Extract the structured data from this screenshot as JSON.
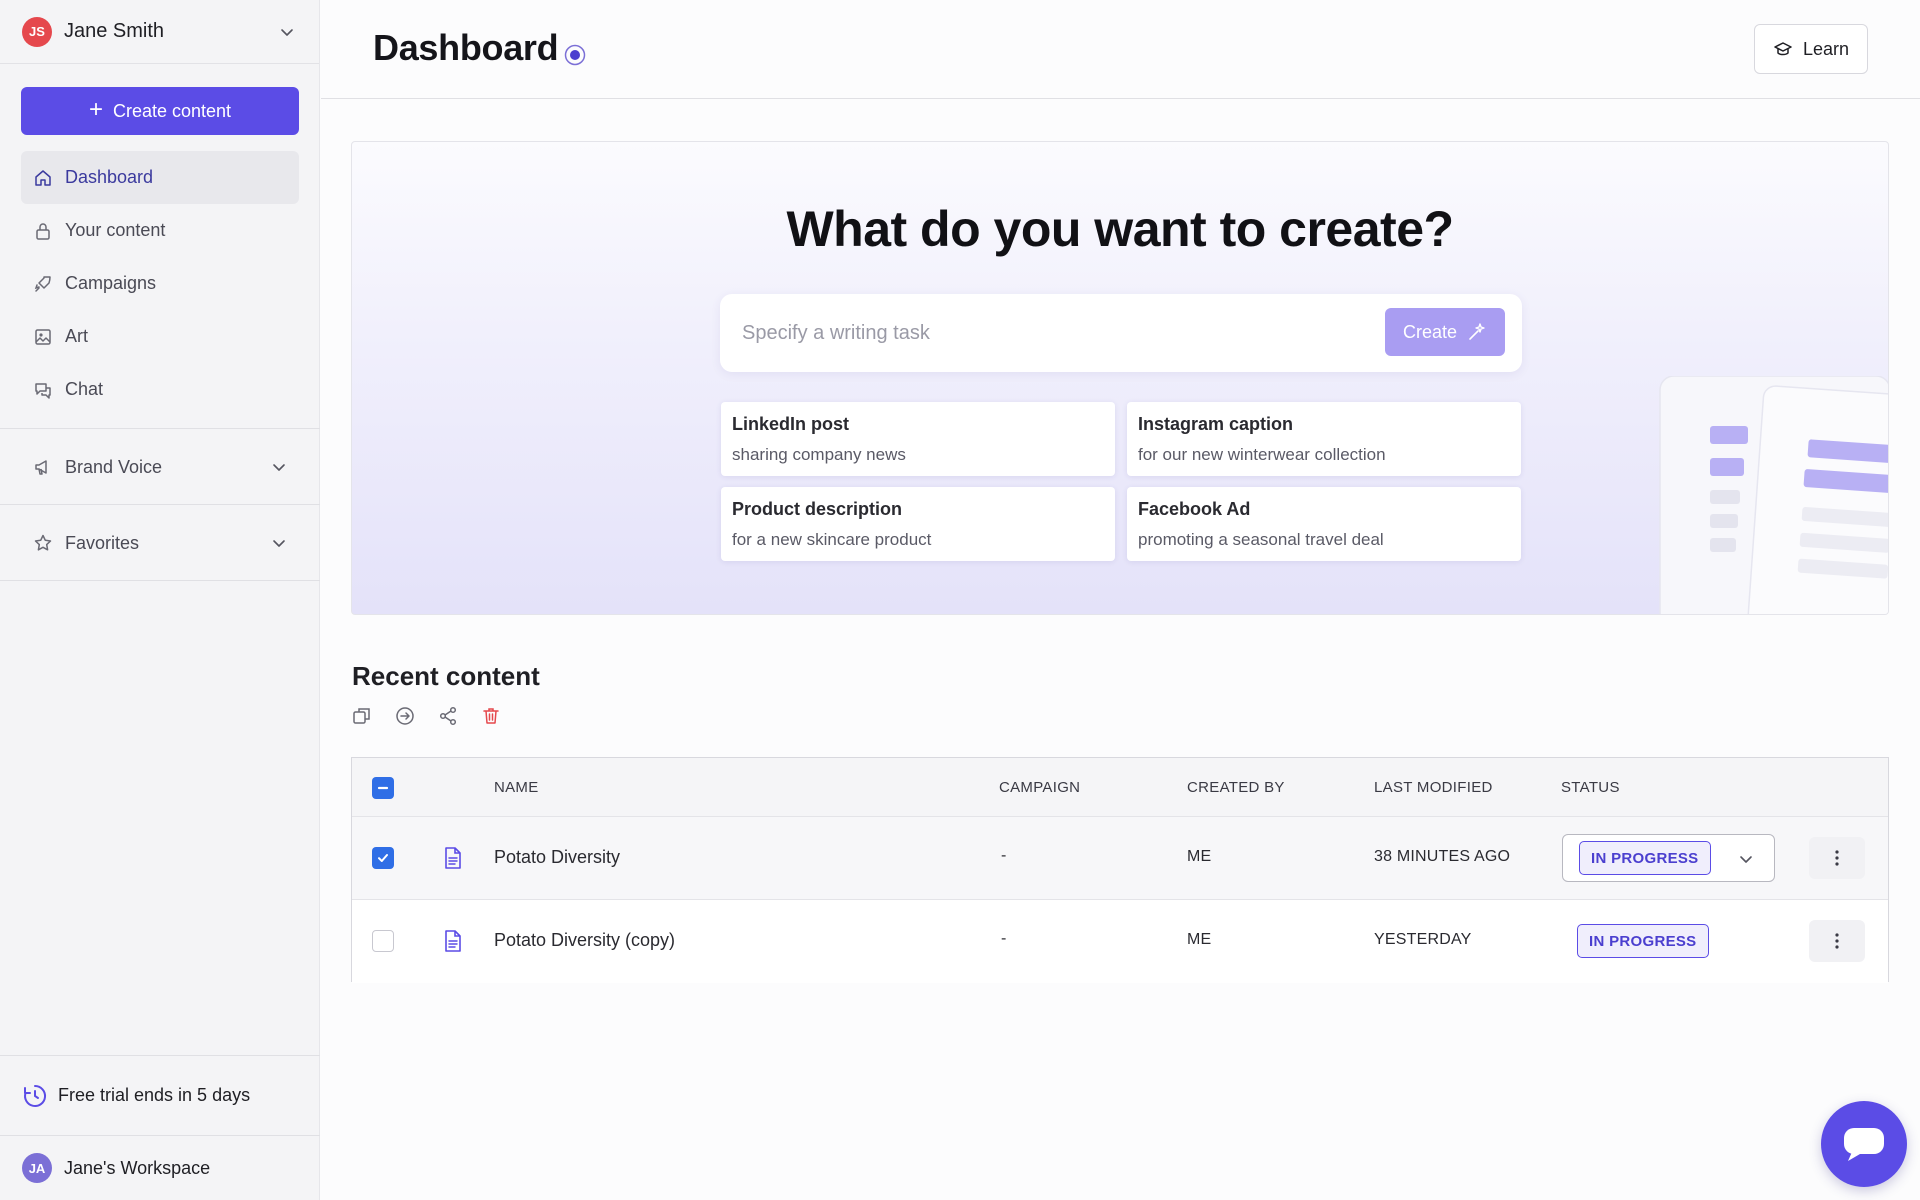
{
  "sidebar": {
    "user": {
      "initials": "JS",
      "name": "Jane Smith"
    },
    "create_label": "Create content",
    "nav": [
      {
        "label": "Dashboard",
        "icon": "home-icon"
      },
      {
        "label": "Your content",
        "icon": "lock-icon"
      },
      {
        "label": "Campaigns",
        "icon": "rocket-icon"
      },
      {
        "label": "Art",
        "icon": "image-icon"
      },
      {
        "label": "Chat",
        "icon": "chat-icon"
      }
    ],
    "brand_voice_label": "Brand Voice",
    "favorites_label": "Favorites",
    "trial_text": "Free trial ends in 5 days",
    "workspace": {
      "initials": "JA",
      "name": "Jane's Workspace"
    }
  },
  "header": {
    "title": "Dashboard",
    "learn_label": "Learn"
  },
  "hero": {
    "title": "What do you want to create?",
    "prompt_placeholder": "Specify a writing task",
    "create_label": "Create",
    "suggestions": [
      {
        "title": "LinkedIn post",
        "subtitle": "sharing company news"
      },
      {
        "title": "Instagram caption",
        "subtitle": "for our new winterwear collection"
      },
      {
        "title": "Product description",
        "subtitle": "for a new skincare product"
      },
      {
        "title": "Facebook Ad",
        "subtitle": "promoting a seasonal travel deal"
      }
    ]
  },
  "recent": {
    "title": "Recent content",
    "columns": [
      "NAME",
      "CAMPAIGN",
      "CREATED BY",
      "LAST MODIFIED",
      "STATUS"
    ],
    "rows": [
      {
        "name": "Potato Diversity",
        "campaign": "-",
        "created_by": "ME",
        "last_modified": "38 MINUTES AGO",
        "status": "IN PROGRESS",
        "checked": true
      },
      {
        "name": "Potato Diversity (copy)",
        "campaign": "-",
        "created_by": "ME",
        "last_modified": "YESTERDAY",
        "status": "IN PROGRESS",
        "checked": false
      }
    ]
  },
  "colors": {
    "accent": "#5b4ce6",
    "checkbox": "#2f6ee6",
    "danger": "#e5484d"
  }
}
